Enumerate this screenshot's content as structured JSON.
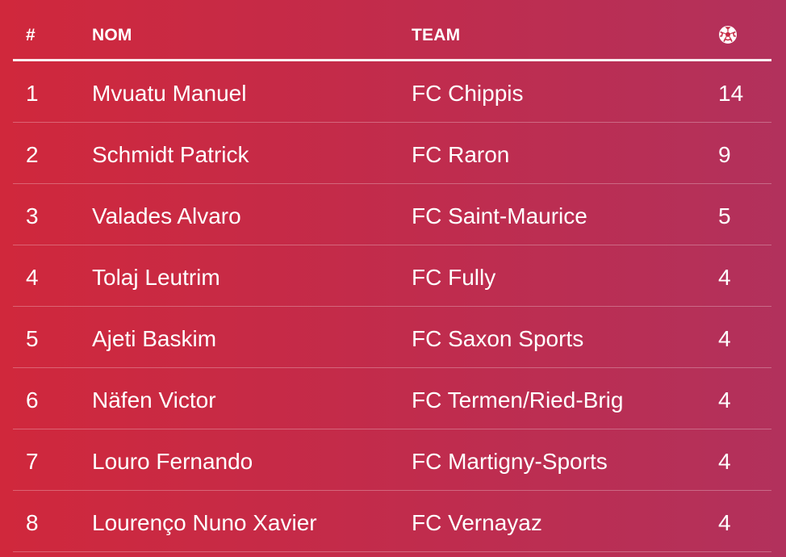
{
  "table": {
    "headers": {
      "rank": "#",
      "name": "NOM",
      "team": "TEAM",
      "goals_icon": "soccer-ball-icon"
    },
    "rows": [
      {
        "rank": "1",
        "name": "Mvuatu Manuel",
        "team": "FC Chippis",
        "goals": "14"
      },
      {
        "rank": "2",
        "name": "Schmidt Patrick",
        "team": "FC Raron",
        "goals": "9"
      },
      {
        "rank": "3",
        "name": "Valades Alvaro",
        "team": "FC Saint-Maurice",
        "goals": "5"
      },
      {
        "rank": "4",
        "name": "Tolaj Leutrim",
        "team": "FC Fully",
        "goals": "4"
      },
      {
        "rank": "5",
        "name": "Ajeti Baskim",
        "team": "FC Saxon Sports",
        "goals": "4"
      },
      {
        "rank": "6",
        "name": "Näfen Victor",
        "team": "FC Termen/Ried-Brig",
        "goals": "4"
      },
      {
        "rank": "7",
        "name": "Louro Fernando",
        "team": "FC Martigny-Sports",
        "goals": "4"
      },
      {
        "rank": "8",
        "name": "Lourenço Nuno Xavier",
        "team": "FC Vernayaz",
        "goals": "4"
      }
    ]
  },
  "colors": {
    "background_start": "#d0283c",
    "background_end": "#b2315c",
    "text": "#ffffff"
  }
}
